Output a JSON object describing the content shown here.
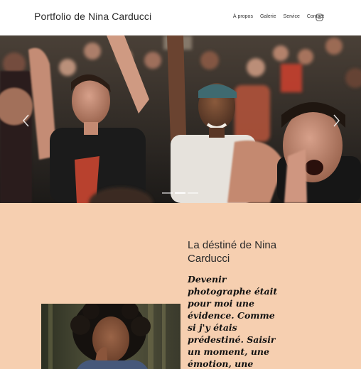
{
  "header": {
    "site_title": "Portfolio de Nina Carducci",
    "nav": [
      {
        "label": "À propos"
      },
      {
        "label": "Galerie"
      },
      {
        "label": "Service"
      },
      {
        "label": "Contact"
      }
    ],
    "social_icon": "instagram-icon"
  },
  "hero": {
    "slide_count": 3,
    "active_slide": 2,
    "prev_icon": "chevron-left-icon",
    "next_icon": "chevron-right-icon"
  },
  "about": {
    "heading": "La déstiné de Nina Carducci",
    "quote": "Devenir photographe était pour moi une évidence. Comme si j'y étais prédestiné. Saisir un moment, une émotion, une situation, un"
  },
  "colors": {
    "about_background": "#f6cfb0",
    "header_background": "#ffffff"
  }
}
